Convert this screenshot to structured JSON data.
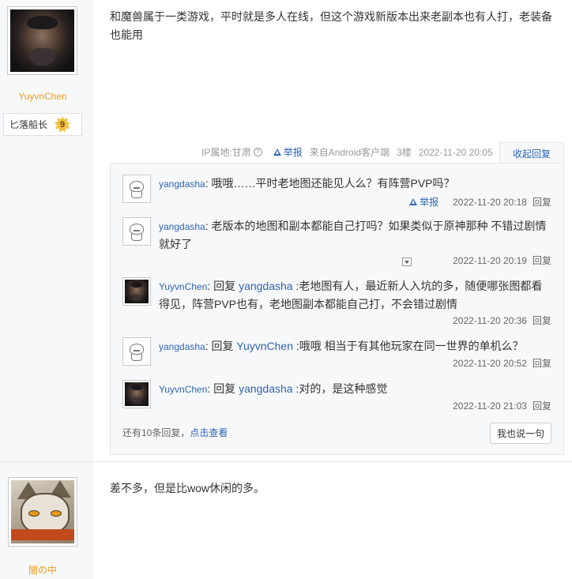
{
  "post1": {
    "author": "YuyvnChen",
    "rank_name": "匕落船长",
    "rank_level": "9",
    "content": "和魔兽属于一类游戏，平时就是多人在线，但这个游戏新版本出来老副本也有人打，老装备也能用",
    "ip_location": "IP属地:甘肃",
    "report_label": "举报",
    "client": "来自Android客户端",
    "floor": "3楼",
    "time": "2022-11-20 20:05",
    "collapse_label": "收起回复",
    "comments": [
      {
        "user": "yangdasha",
        "reply_prefix": "",
        "reply_to": "",
        "text": "哦哦……平时老地图还能见人么？有阵营PVP吗？",
        "report": "举报",
        "time": "2022-11-20 20:18",
        "reply": "回复"
      },
      {
        "user": "yangdasha",
        "reply_prefix": "",
        "reply_to": "",
        "text": "老版本的地图和副本都能自己打吗？如果类似于原神那种 不错过剧情就好了",
        "report": "",
        "time": "2022-11-20 20:19",
        "reply": "回复"
      },
      {
        "user": "YuyvnChen",
        "reply_prefix": "回复 ",
        "reply_to": "yangdasha",
        "text": " :老地图有人，最近新人入坑的多，随便哪张图都看得见，阵营PVP也有，老地图副本都能自己打，不会错过剧情",
        "report": "",
        "time": "2022-11-20 20:36",
        "reply": "回复"
      },
      {
        "user": "yangdasha",
        "reply_prefix": "回复 ",
        "reply_to": "YuyvnChen",
        "text": " :哦哦 相当于有其他玩家在同一世界的单机么？",
        "report": "",
        "time": "2022-11-20 20:52",
        "reply": "回复"
      },
      {
        "user": "YuyvnChen",
        "reply_prefix": "回复 ",
        "reply_to": "yangdasha",
        "text": " :对的，是这种感觉",
        "report": "",
        "time": "2022-11-20 21:03",
        "reply": "回复"
      }
    ],
    "more_text": "还有10条回复，",
    "more_link": "点击查看",
    "say_button": "我也说一句"
  },
  "post2": {
    "author": "闇の中",
    "content": "差不多，但是比wow休闲的多。"
  },
  "colors": {
    "link": "#2d64b3",
    "username": "#f29b1f",
    "sidebar_bg": "#f7f8fa"
  }
}
